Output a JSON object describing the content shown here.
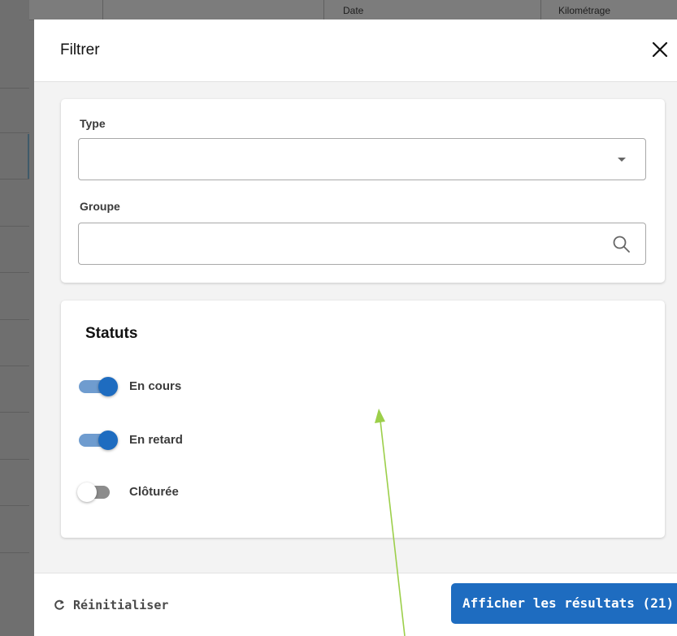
{
  "background_table": {
    "headers": [
      "Date",
      "Kilométrage"
    ]
  },
  "modal": {
    "title": "Filtrer",
    "close_icon": "close-icon"
  },
  "filters": {
    "type": {
      "label": "Type",
      "value": "",
      "icon": "chevron-down-icon"
    },
    "groupe": {
      "label": "Groupe",
      "value": "",
      "icon": "search-icon"
    }
  },
  "statuts": {
    "title": "Statuts",
    "items": [
      {
        "label": "En cours",
        "enabled": true
      },
      {
        "label": "En retard",
        "enabled": true
      },
      {
        "label": "Clôturée",
        "enabled": false
      }
    ]
  },
  "footer": {
    "reset_label": "Réinitialiser",
    "reset_icon": "refresh-icon",
    "apply_label": "Afficher les résultats (21)"
  },
  "colors": {
    "accent": "#1e6cc0",
    "toggle_track_on": "#6f9ccf",
    "annotation_arrow": "#9ccf4a"
  }
}
